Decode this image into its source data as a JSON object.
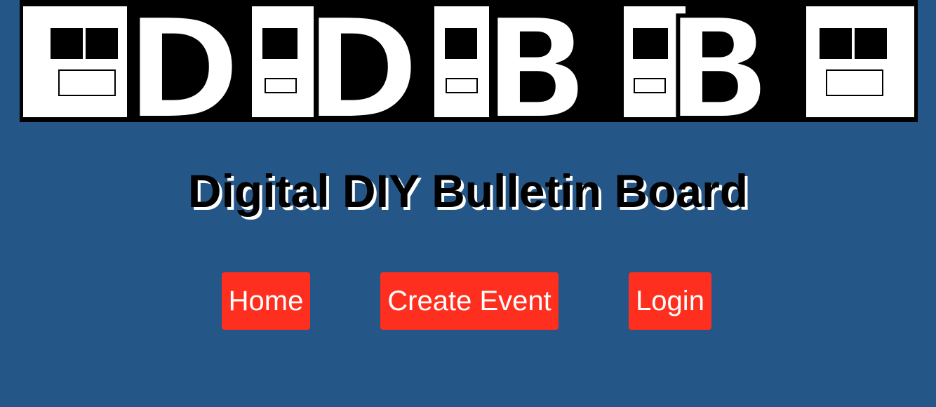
{
  "banner": {
    "logo_text": "DDBB"
  },
  "header": {
    "title": "Digital DIY Bulletin Board"
  },
  "nav": {
    "home_label": "Home",
    "create_event_label": "Create Event",
    "login_label": "Login"
  },
  "colors": {
    "background": "#245688",
    "button": "#ff2f1f",
    "button_text": "#ffffff"
  }
}
